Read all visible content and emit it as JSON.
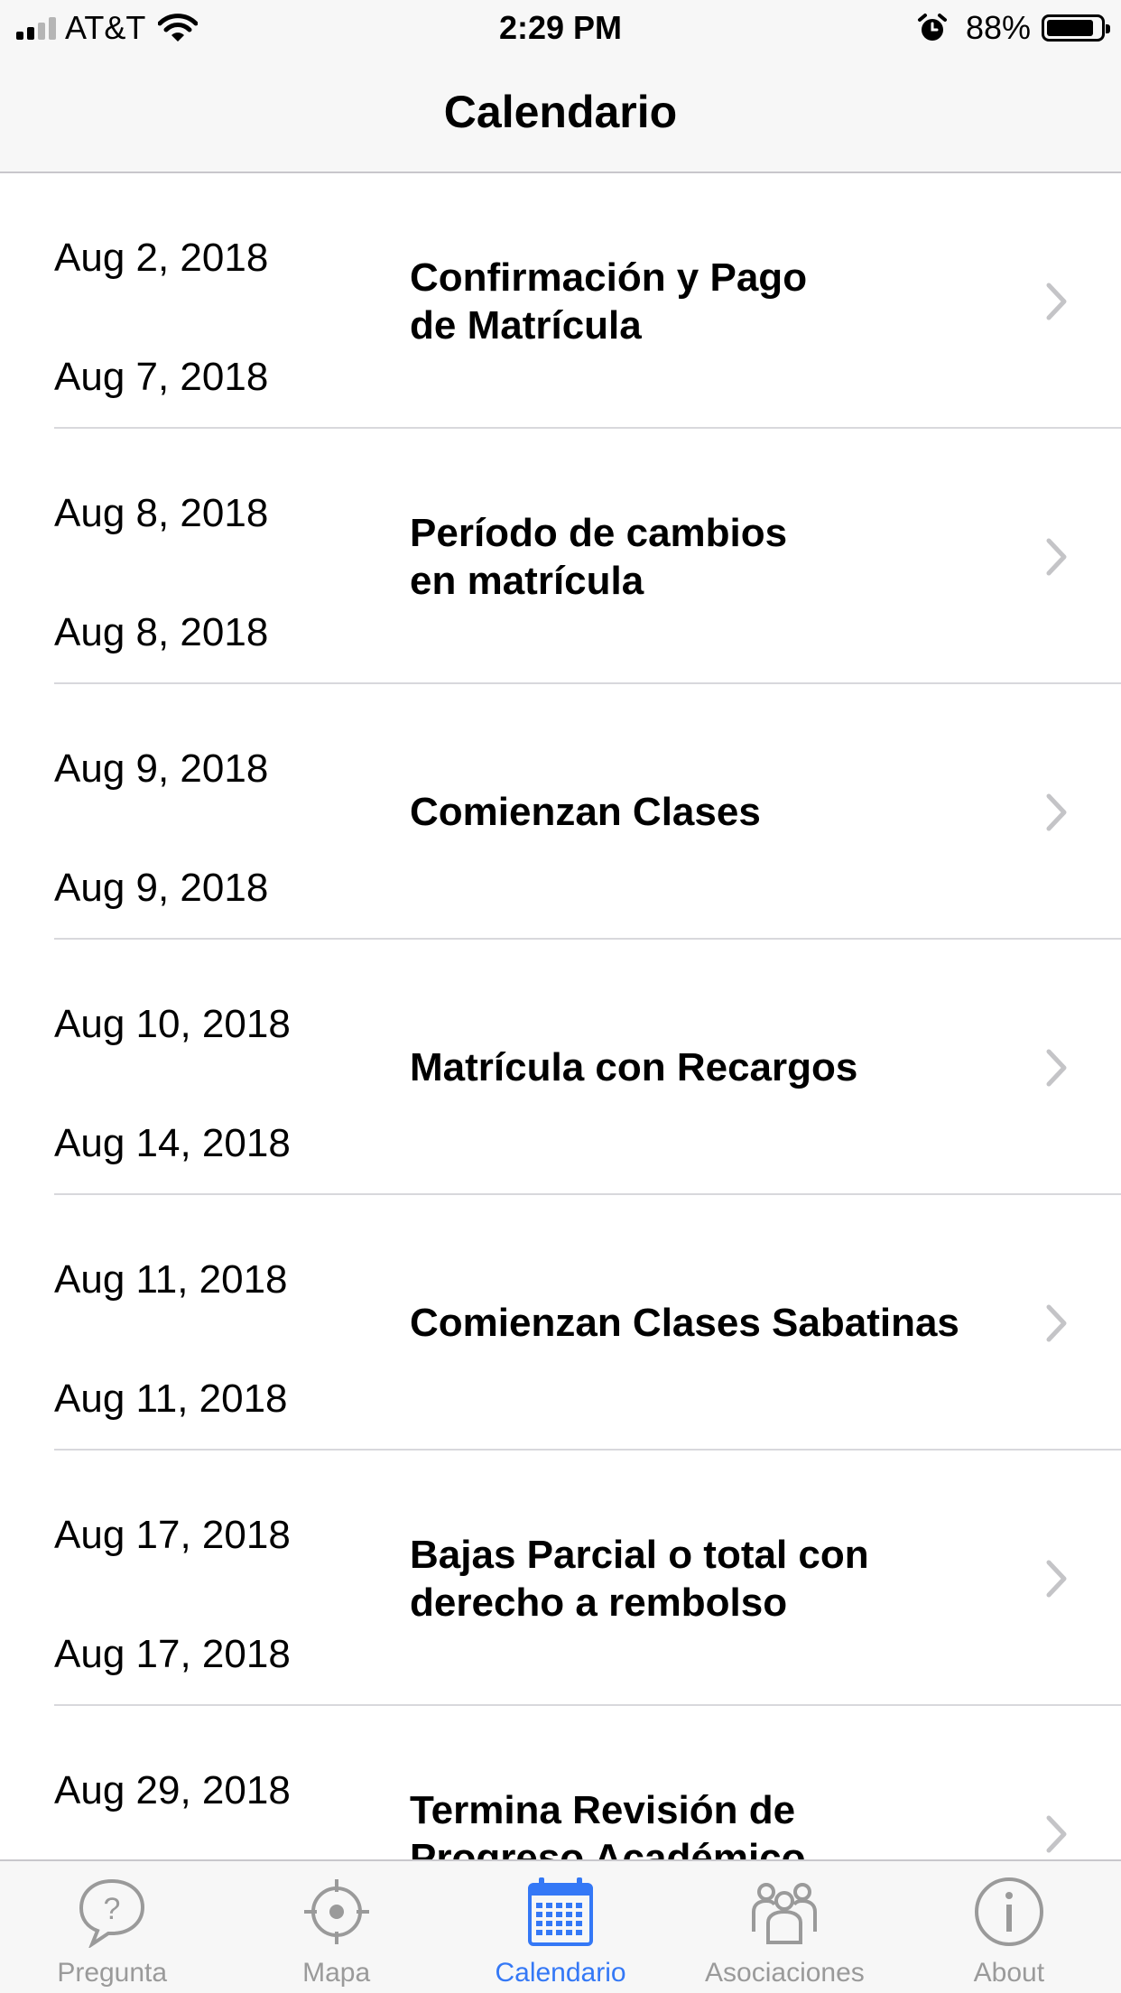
{
  "status_bar": {
    "carrier": "AT&T",
    "time": "2:29 PM",
    "battery_percent": "88%",
    "battery_level": 0.88,
    "icons": [
      "signal-icon",
      "wifi-icon",
      "alarm-icon",
      "battery-icon"
    ]
  },
  "nav": {
    "title": "Calendario"
  },
  "events": [
    {
      "start": "Aug 2, 2018",
      "end": "Aug 7, 2018",
      "title_lines": [
        "Confirmación y Pago",
        "de Matrícula"
      ]
    },
    {
      "start": "Aug 8, 2018",
      "end": "Aug 8, 2018",
      "title_lines": [
        "Período de cambios",
        "en matrícula"
      ]
    },
    {
      "start": "Aug 9, 2018",
      "end": "Aug 9, 2018",
      "title_lines": [
        "Comienzan Clases"
      ]
    },
    {
      "start": "Aug 10, 2018",
      "end": "Aug 14, 2018",
      "title_lines": [
        "Matrícula con Recargos"
      ]
    },
    {
      "start": "Aug 11, 2018",
      "end": "Aug 11, 2018",
      "title_lines": [
        "Comienzan Clases Sabatinas"
      ]
    },
    {
      "start": "Aug 17, 2018",
      "end": "Aug 17, 2018",
      "title_lines": [
        "Bajas Parcial o total con",
        "derecho a rembolso"
      ]
    },
    {
      "start": "Aug 29, 2018",
      "end": "",
      "title_lines": [
        "Termina Revisión de",
        "Progreso Académico"
      ]
    }
  ],
  "tabs": [
    {
      "label": "Pregunta",
      "icon": "question-bubble-icon",
      "active": false
    },
    {
      "label": "Mapa",
      "icon": "location-target-icon",
      "active": false
    },
    {
      "label": "Calendario",
      "icon": "calendar-icon",
      "active": true
    },
    {
      "label": "Asociaciones",
      "icon": "group-people-icon",
      "active": false
    },
    {
      "label": "About",
      "icon": "info-icon",
      "active": false
    }
  ],
  "colors": {
    "accent": "#3478f6",
    "inactive_tab": "#9a9a9a",
    "bar_background": "#f7f7f7",
    "separator": "#d8d8dc",
    "chevron": "#c4c4c7"
  }
}
